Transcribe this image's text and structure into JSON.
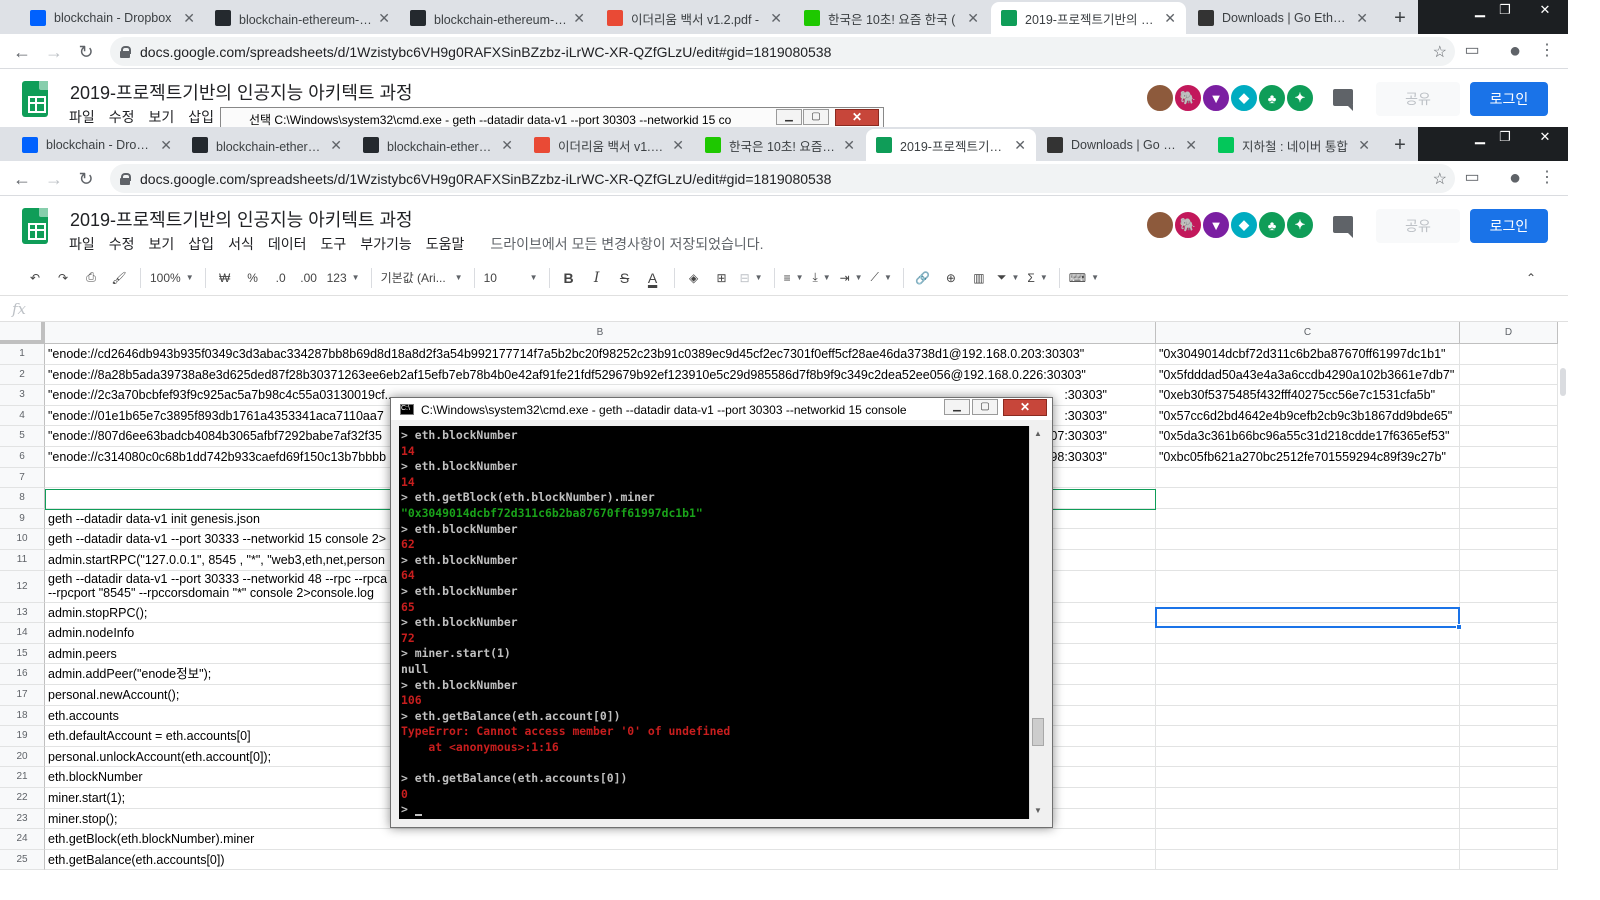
{
  "browser_back": {
    "tabs": [
      "blockchain - Dropbox",
      "blockchain-ethereum-발표",
      "blockchain-ethereum-발표",
      "이더리움 백서 v1.2.pdf -",
      "한국은 10초! 요즘 한국 (",
      "2019-프로젝트기반의 인공",
      "Downloads | Go Ethereum"
    ],
    "url": "docs.google.com/spreadsheets/d/1Wzistybc6VH9g0RAFXSinBZzbz-iLrWC-XR-QZfGLzU/edit#gid=1819080538",
    "title": "2019-프로젝트기반의 인공지능 아키텍트 과정",
    "menu_partial": [
      "파일",
      "수정",
      "보기",
      "삽입"
    ],
    "ghost_console_title": "선택 C:\\Windows\\system32\\cmd.exe - geth  --datadir data-v1 --port 30303 --networkid 15 co"
  },
  "browser": {
    "tabs": [
      {
        "label": "blockchain - Dropbox",
        "icon": "dropbox-icon",
        "color": "#0061fe"
      },
      {
        "label": "blockchain-ethereum-발표",
        "icon": "github-icon",
        "color": "#24292e"
      },
      {
        "label": "blockchain-ethereum-발표",
        "icon": "github-icon",
        "color": "#24292e"
      },
      {
        "label": "이더리움 백서 v1.2.pdf",
        "icon": "pdf-icon",
        "color": "#e94a35"
      },
      {
        "label": "한국은 10초! 요즘 한국",
        "icon": "green-bookmark-icon",
        "color": "#1ec800"
      },
      {
        "label": "2019-프로젝트기반의",
        "icon": "sheets-icon",
        "color": "#0f9d58"
      },
      {
        "label": "Downloads | Go Ethereum",
        "icon": "geth-icon",
        "color": "#333333"
      },
      {
        "label": "지하철 : 네이버 통합",
        "icon": "naver-icon",
        "color": "#03c75a"
      }
    ],
    "active_tab": 5,
    "url": "docs.google.com/spreadsheets/d/1Wzistybc6VH9g0RAFXSinBZzbz-iLrWC-XR-QZfGLzU/edit#gid=1819080538"
  },
  "sheets": {
    "title": "2019-프로젝트기반의 인공지능 아키텍트 과정",
    "menu": [
      "파일",
      "수정",
      "보기",
      "삽입",
      "서식",
      "데이터",
      "도구",
      "부가기능",
      "도움말"
    ],
    "saved_msg": "드라이브에서 모든 변경사항이 저장되었습니다.",
    "share_label": "공유",
    "login_label": "로그인",
    "toolbar": {
      "zoom": "100%",
      "currency": "₩",
      "percent": "%",
      "dec_less": ".0",
      "dec_more": ".00",
      "format_more": "123",
      "font": "기본값 (Ari...",
      "size": "10"
    },
    "fx_label": "fx"
  },
  "grid": {
    "columns": [
      "B",
      "C",
      "D"
    ],
    "rows": [
      {
        "n": "1",
        "b": "\"enode://cd2646db943b935f0349c3d3abac334287bb8b69d8d18a8d2f3a54b992177714f7a5b2bc20f98252c23b91c0389ec9d45cf2ec7301f0eff5cf28ae46da3738d1@192.168.0.203:30303\"",
        "c": "\"0x3049014dcbf72d311c6b2ba87670ff61997dc1b1\""
      },
      {
        "n": "2",
        "b": "\"enode://8a28b5ada39738a8e3d625ded87f28b30371263ee6eb2af15efb7eb78b4b0e42af91fe21fdf529679b92ef123910e5c29d985586d7f8b9f9c349c2dea52ee056@192.168.0.226:30303\"",
        "c": "\"0x5fdddad50a43e4a3a6ccdb4290a102b3661e7db7\""
      },
      {
        "n": "3",
        "b": "\"enode://2c3a70bcbfef93f9c925ac5a7b98c4c55a03130019cf...",
        "c": "\"0xeb30f5375485f432fff40275cc56e7c1531cfa5b\"",
        "b_tail": ":30303\""
      },
      {
        "n": "4",
        "b": "\"enode://01e1b65e7c3895f893db1761a4353341aca7110aa7",
        "c": "\"0x57cc6d2bd4642e4b9cefb2cb9c3b1867dd9bde65\"",
        "b_tail": ":30303\""
      },
      {
        "n": "5",
        "b": "\"enode://807d6ee63badcb4084b3065afbf7292babe7af32f35",
        "c": "\"0x5da3c361b66bc96a55c31d218cdde17f6365ef53\"",
        "b_tail": "07:30303\""
      },
      {
        "n": "6",
        "b": "\"enode://c314080c0c68b1dd742b933caefd69f150c13b7bbbb",
        "c": "\"0xbc05fb621a270bc2512fe701559294c89f39c27b\"",
        "b_tail": "98:30303\""
      },
      {
        "n": "7",
        "b": "",
        "c": ""
      },
      {
        "n": "8",
        "b": "",
        "c": ""
      },
      {
        "n": "9",
        "b": "geth --datadir data-v1 init genesis.json",
        "c": ""
      },
      {
        "n": "10",
        "b": "geth --datadir data-v1 --port 30333 --networkid 15 console 2>",
        "c": ""
      },
      {
        "n": "11",
        "b": "admin.startRPC(\"127.0.0.1\", 8545 , \"*\", \"web3,eth,net,person",
        "c": ""
      },
      {
        "n": "12",
        "b": "geth --datadir data-v1 --port 30333 --networkid 48 --rpc --rpca",
        "b2": "--rpcport \"8545\" --rpccorsdomain \"*\"  console 2>console.log",
        "c": ""
      },
      {
        "n": "13",
        "b": "admin.stopRPC();",
        "c": ""
      },
      {
        "n": "14",
        "b": "admin.nodeInfo",
        "c": ""
      },
      {
        "n": "15",
        "b": "admin.peers",
        "c": ""
      },
      {
        "n": "16",
        "b": "admin.addPeer(\"enode정보\");",
        "c": ""
      },
      {
        "n": "17",
        "b": "personal.newAccount();",
        "c": ""
      },
      {
        "n": "18",
        "b": "eth.accounts",
        "c": ""
      },
      {
        "n": "19",
        "b": "eth.defaultAccount = eth.accounts[0]",
        "c": ""
      },
      {
        "n": "20",
        "b": "personal.unlockAccount(eth.account[0]);",
        "c": ""
      },
      {
        "n": "21",
        "b": "eth.blockNumber",
        "c": ""
      },
      {
        "n": "22",
        "b": "miner.start(1);",
        "c": ""
      },
      {
        "n": "23",
        "b": "miner.stop();",
        "c": ""
      },
      {
        "n": "24",
        "b": "eth.getBlock(eth.blockNumber).miner",
        "c": ""
      },
      {
        "n": "25",
        "b": "eth.getBalance(eth.accounts[0])",
        "c": ""
      }
    ]
  },
  "console": {
    "title": "C:\\Windows\\system32\\cmd.exe - geth  --datadir data-v1 --port 30303 --networkid 15 console",
    "lines": [
      {
        "t": "> eth.blockNumber",
        "c": "white"
      },
      {
        "t": "14",
        "c": "red"
      },
      {
        "t": "> eth.blockNumber",
        "c": "white"
      },
      {
        "t": "14",
        "c": "red"
      },
      {
        "t": "> eth.getBlock(eth.blockNumber).miner",
        "c": "white"
      },
      {
        "t": "\"0x3049014dcbf72d311c6b2ba87670ff61997dc1b1\"",
        "c": "green"
      },
      {
        "t": "> eth.blockNumber",
        "c": "white"
      },
      {
        "t": "62",
        "c": "red"
      },
      {
        "t": "> eth.blockNumber",
        "c": "white"
      },
      {
        "t": "64",
        "c": "red"
      },
      {
        "t": "> eth.blockNumber",
        "c": "white"
      },
      {
        "t": "65",
        "c": "red"
      },
      {
        "t": "> eth.blockNumber",
        "c": "white"
      },
      {
        "t": "72",
        "c": "red"
      },
      {
        "t": "> miner.start(1)",
        "c": "white"
      },
      {
        "t": "null",
        "c": "white"
      },
      {
        "t": "> eth.blockNumber",
        "c": "white"
      },
      {
        "t": "106",
        "c": "red"
      },
      {
        "t": "> eth.getBalance(eth.account[0])",
        "c": "white"
      },
      {
        "t": "TypeError: Cannot access member '0' of undefined",
        "c": "red"
      },
      {
        "t": "    at <anonymous>:1:16",
        "c": "red"
      },
      {
        "t": "",
        "c": "white"
      },
      {
        "t": "> eth.getBalance(eth.accounts[0])",
        "c": "white"
      },
      {
        "t": "0",
        "c": "red"
      },
      {
        "t": "> ",
        "c": "white",
        "cursor": true
      }
    ]
  },
  "colors": {
    "sheets_green": "#0f9d58",
    "login_blue": "#1a73e8",
    "console_red": "#c81e1e",
    "console_green": "#1aa31a"
  }
}
